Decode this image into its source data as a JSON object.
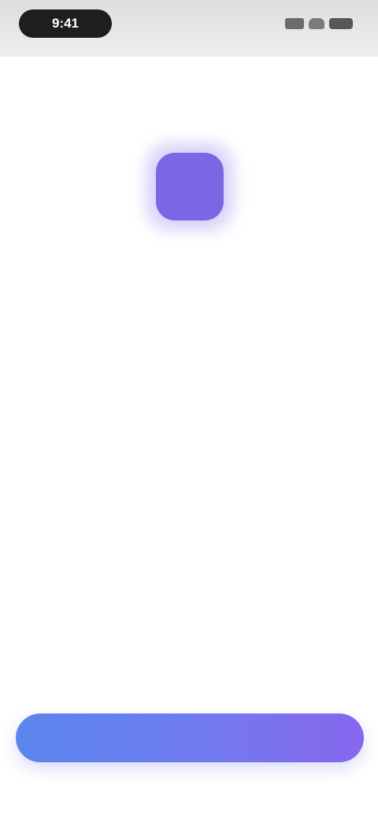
{
  "status_bar": {
    "time": "9:41",
    "signal_icon": "signal-icon",
    "wifi_icon": "wifi-icon",
    "battery_icon": "battery-icon"
  },
  "app_icon": {
    "icon": "app-icon",
    "color": "#7b67e4"
  },
  "header": {
    "title": "",
    "subtitle_line_1": "",
    "subtitle_line_2": ""
  },
  "body": {
    "paragraph_1": "",
    "paragraph_2": ""
  },
  "cta": {
    "label": ""
  },
  "colors": {
    "accent_start": "#5b86ee",
    "accent_end": "#8867ee",
    "text_primary": "#222222",
    "text_secondary": "#666666"
  }
}
